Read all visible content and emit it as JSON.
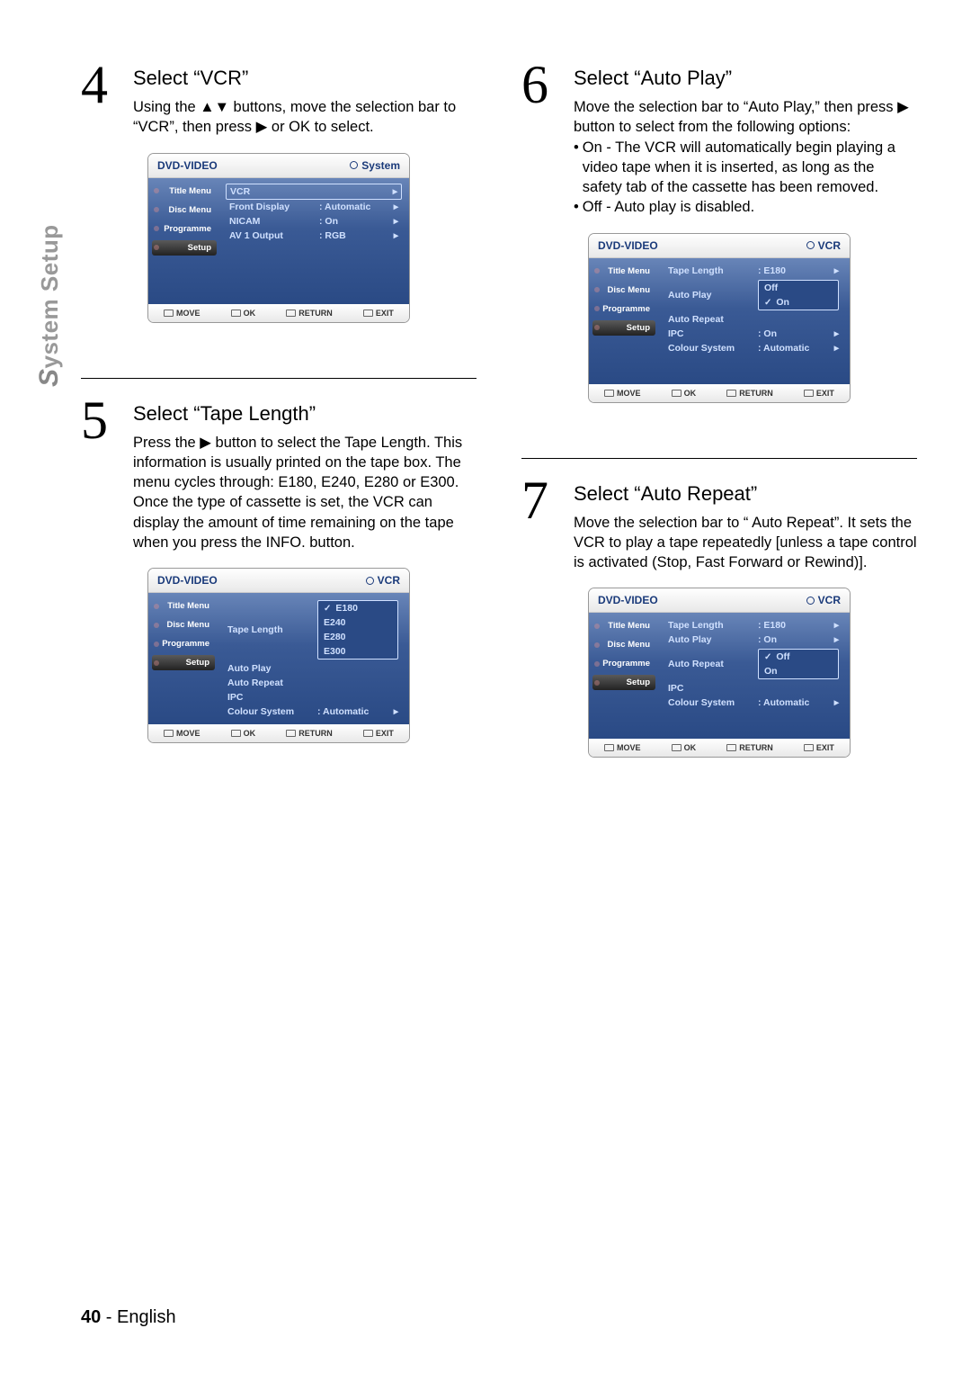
{
  "sideLabel": "System Setup",
  "footer": {
    "page": "40",
    "sep": " - ",
    "lang": "English"
  },
  "common": {
    "osd_header_left": "DVD-VIDEO",
    "tabs": {
      "title": "Title Menu",
      "disc": "Disc Menu",
      "prog": "Programme",
      "setup": "Setup"
    },
    "footer_move": "MOVE",
    "footer_ok": "OK",
    "footer_return": "RETURN",
    "footer_exit": "EXIT"
  },
  "step4": {
    "num": "4",
    "title": "Select “VCR”",
    "text": "Using the ▲▼ buttons, move the selection bar to “VCR”, then press ▶ or OK to select.",
    "osd_header_right": "System",
    "rows": {
      "vcr": "VCR",
      "fd": "Front Display",
      "fd_v": ": Automatic",
      "nicam": "NICAM",
      "nicam_v": ": On",
      "av1": "AV 1 Output",
      "av1_v": ": RGB"
    }
  },
  "step5": {
    "num": "5",
    "title": "Select “Tape Length”",
    "text1": "Press the ▶ button to select the Tape Length. This information is usually printed on the tape box. The menu cycles through: E180, E240, E280 or E300.",
    "text2": "Once the type of cassette is set, the VCR can display the amount of time remaining on the tape when you press the INFO. button.",
    "osd_header_right": "VCR",
    "rows": {
      "tl": "Tape Length",
      "ap": "Auto Play",
      "ar": "Auto Repeat",
      "ipc": "IPC",
      "cs": "Colour System",
      "cs_v": ": Automatic"
    },
    "opts": {
      "e180": "E180",
      "e240": "E240",
      "e280": "E280",
      "e300": "E300"
    }
  },
  "step6": {
    "num": "6",
    "title": "Select “Auto Play”",
    "text1": "Move the selection bar to “Auto Play,” then press ▶ button to select from the following options:",
    "bullet_on": "On - The VCR will automatically begin playing a video tape when it is inserted, as long as the safety tab of the cassette has been removed.",
    "bullet_off": "Off - Auto play is disabled.",
    "osd_header_right": "VCR",
    "rows": {
      "tl": "Tape Length",
      "tl_v": ": E180",
      "ap": "Auto Play",
      "ar": "Auto Repeat",
      "ipc": "IPC",
      "ipc_v": ": On",
      "cs": "Colour System",
      "cs_v": ": Automatic"
    },
    "opts": {
      "off": "Off",
      "on": "On"
    }
  },
  "step7": {
    "num": "7",
    "title": "Select “Auto Repeat”",
    "text": "Move the selection bar to “ Auto Repeat”. It sets the VCR to play a tape repeatedly [unless a tape control is activated (Stop, Fast Forward or Rewind)].",
    "osd_header_right": "VCR",
    "rows": {
      "tl": "Tape Length",
      "tl_v": ": E180",
      "ap": "Auto Play",
      "ap_v": ": On",
      "ar": "Auto Repeat",
      "ipc": "IPC",
      "cs": "Colour System",
      "cs_v": ": Automatic"
    },
    "opts": {
      "off": "Off",
      "on": "On"
    }
  }
}
